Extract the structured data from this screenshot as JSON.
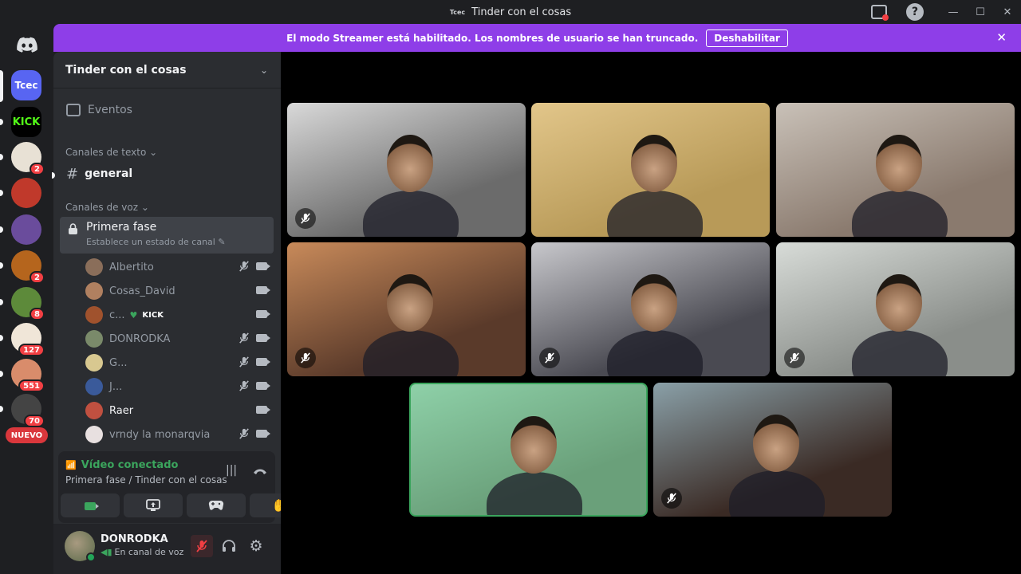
{
  "titlebar": {
    "icon_text": "Tcec",
    "title": "Tinder con el cosas"
  },
  "banner": {
    "message": "El modo Streamer está habilitado. Los nombres de usuario se han truncado.",
    "disable_label": "Deshabilitar",
    "close": "✕"
  },
  "rail": {
    "servers": [
      {
        "label": "Tcec",
        "color": "#5865f2",
        "badge": ""
      },
      {
        "label": "KICK",
        "color": "#000000",
        "badge": ""
      },
      {
        "label": "",
        "color": "#e8e1d5",
        "badge": "2"
      },
      {
        "label": "",
        "color": "#c0392b",
        "badge": ""
      },
      {
        "label": "",
        "color": "#6a4c9c",
        "badge": ""
      },
      {
        "label": "",
        "color": "#b5651d",
        "badge": "2"
      },
      {
        "label": "",
        "color": "#5d8a3a",
        "badge": "8"
      },
      {
        "label": "",
        "color": "#f0e6d8",
        "badge": "127"
      },
      {
        "label": "",
        "color": "#d98c6b",
        "badge": "551"
      },
      {
        "label": "",
        "color": "#444444",
        "badge": "70"
      }
    ],
    "new_label": "NUEVO"
  },
  "sidebar": {
    "guild_name": "Tinder con el cosas",
    "events_label": "Eventos",
    "text_category": "Canales de texto",
    "text_channel": "general",
    "voice_category": "Canales de voz",
    "voice_channel": "Primera fase",
    "voice_status": "Establece un estado de canal",
    "members": [
      {
        "name": "Albertito",
        "muted": true,
        "bright": false,
        "color": "#8a6e5a"
      },
      {
        "name": "Cosas_David",
        "muted": false,
        "bright": false,
        "color": "#b08060"
      },
      {
        "name": "c...",
        "muted": false,
        "bright": false,
        "color": "#a0522d",
        "tag": "KICK"
      },
      {
        "name": "DONRODKA",
        "muted": true,
        "bright": false,
        "color": "#7a8a6a"
      },
      {
        "name": "G...",
        "muted": true,
        "bright": false,
        "color": "#d8c890"
      },
      {
        "name": "J...",
        "muted": true,
        "bright": false,
        "color": "#3a5a9a"
      },
      {
        "name": "Raer",
        "muted": false,
        "bright": true,
        "color": "#c05040"
      },
      {
        "name": "vrndy la monarqvia",
        "muted": true,
        "bright": false,
        "color": "#e8e0e0"
      }
    ]
  },
  "voice_panel": {
    "status": "Vídeo conectado",
    "location": "Primera fase / Tinder con el cosas"
  },
  "user": {
    "name": "DONRODKA",
    "status": "En canal de voz"
  },
  "tiles": [
    {
      "muted": true,
      "speaking": false,
      "bg": "#6b6b6b",
      "wall": "#d9d9d9"
    },
    {
      "muted": false,
      "speaking": false,
      "bg": "#b89a58",
      "wall": "#e2c68a"
    },
    {
      "muted": false,
      "speaking": false,
      "bg": "#8a7a6e",
      "wall": "#c9c1b8"
    },
    {
      "muted": true,
      "speaking": false,
      "bg": "#5a3a2a",
      "wall": "#c88a5a"
    },
    {
      "muted": true,
      "speaking": false,
      "bg": "#4a4a52",
      "wall": "#c8c8cc"
    },
    {
      "muted": true,
      "speaking": false,
      "bg": "#8a8e8a",
      "wall": "#d8dcd8"
    },
    {
      "muted": false,
      "speaking": true,
      "bg": "#6aa07a",
      "wall": "#8ed0a8"
    },
    {
      "muted": true,
      "speaking": false,
      "bg": "#3a2a24",
      "wall": "#8aa0a8"
    }
  ]
}
